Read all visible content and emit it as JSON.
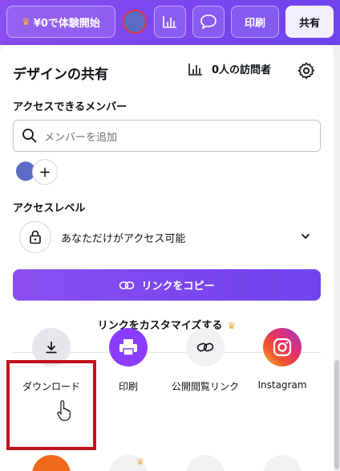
{
  "topbar": {
    "trial_label": "¥0で体験開始",
    "print_label": "印刷",
    "share_label": "共有"
  },
  "panel": {
    "title": "デザインの共有",
    "visitors": "0人の訪問者",
    "members_label": "アクセスできるメンバー",
    "search_placeholder": "メンバーを追加",
    "access_label": "アクセスレベル",
    "access_value": "あなただけがアクセス可能",
    "copy_link_label": "リンクをコピー",
    "customize_label": "リンクをカスタマイズする"
  },
  "share_options": [
    {
      "label": "ダウンロード",
      "icon": "download-icon"
    },
    {
      "label": "印刷",
      "icon": "printer-icon"
    },
    {
      "label": "公開閲覧リンク",
      "icon": "link-icon"
    },
    {
      "label": "Instagram",
      "icon": "instagram-icon"
    }
  ],
  "colors": {
    "brand_purple": "#7b46ef",
    "avatar": "#5b6cc4",
    "highlight": "#c1121b",
    "crown": "#f5b041"
  }
}
